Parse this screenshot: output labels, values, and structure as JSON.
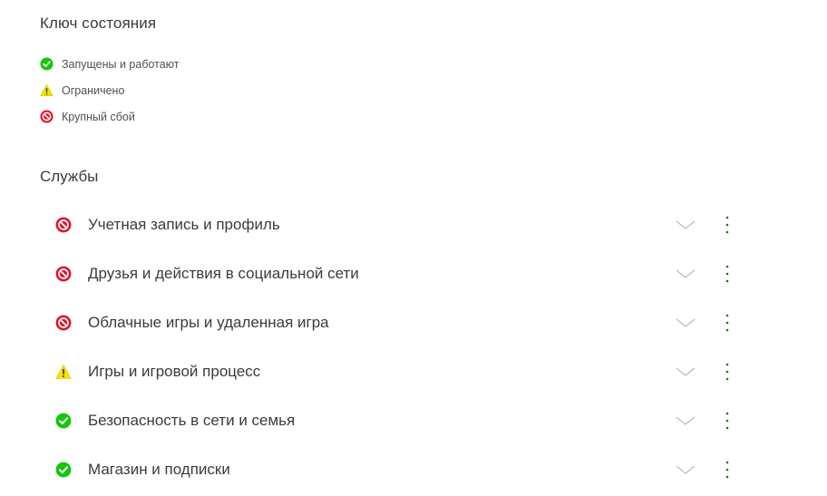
{
  "status_key": {
    "title": "Ключ состояния",
    "items": [
      {
        "label": "Запущены и работают",
        "icon": "check-circle-icon",
        "color": "#16c60c"
      },
      {
        "label": "Ограничено",
        "icon": "warning-icon",
        "color": "#f5e400"
      },
      {
        "label": "Крупный сбой",
        "icon": "blocked-icon",
        "color": "#e81123"
      }
    ]
  },
  "services": {
    "title": "Службы",
    "items": [
      {
        "name": "Учетная запись и профиль",
        "status": "blocked"
      },
      {
        "name": "Друзья и действия в социальной сети",
        "status": "blocked"
      },
      {
        "name": "Облачные игры и удаленная игра",
        "status": "blocked"
      },
      {
        "name": "Игры и игровой процесс",
        "status": "warning"
      },
      {
        "name": "Безопасность в сети и семья",
        "status": "ok"
      },
      {
        "name": "Магазин и подписки",
        "status": "ok"
      }
    ]
  },
  "colors": {
    "ok": "#16c60c",
    "warning": "#f5e400",
    "blocked": "#e81123",
    "accent": "#107c10",
    "chevron": "#bdbdbd"
  }
}
